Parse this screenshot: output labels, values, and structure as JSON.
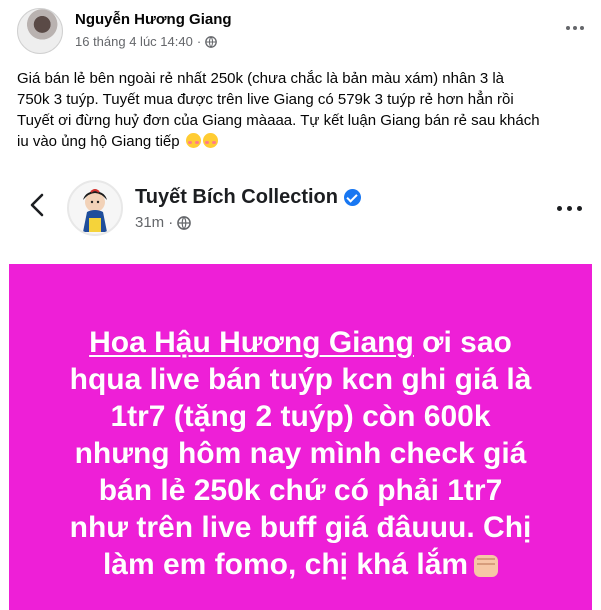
{
  "post": {
    "author": "Nguyễn Hương Giang",
    "timestamp": "16 tháng 4 lúc 14:40",
    "separator": "·",
    "privacy_icon": "globe-icon",
    "caption_line1": "Giá bán lẻ bên ngoài rẻ nhất 250k (chưa chắc là bản màu xám) nhân 3 là",
    "caption_line2": "750k 3 tuýp. Tuyết mua được trên live Giang có 579k 3 tuýp rẻ hơn hẳn rồi",
    "caption_line3": "Tuyết ơi đừng huỷ đơn của Giang màaaa. Tự kết luận Giang bán rẻ sau khách",
    "caption_line4": "iu vào ủng hộ Giang tiếp"
  },
  "embed": {
    "page_name": "Tuyết Bích Collection",
    "time": "31m",
    "separator": "·",
    "privacy_icon": "globe-icon",
    "card_color": "#ee1fd7",
    "text": {
      "underlined": "Hoa Hậu Hương Giang",
      "line1_rest": " ơi sao",
      "line2": "hqua live bán tuýp kcn ghi giá là",
      "line3": "1tr7 (tặng 2 tuýp) còn 600k",
      "line4": "nhưng hôm nay mình check giá",
      "line5": "bán lẻ 250k chứ có phải 1tr7",
      "line6": "như trên live buff giá đâuuu. Chị",
      "line7": "làm em fomo, chị khá lắm"
    }
  }
}
